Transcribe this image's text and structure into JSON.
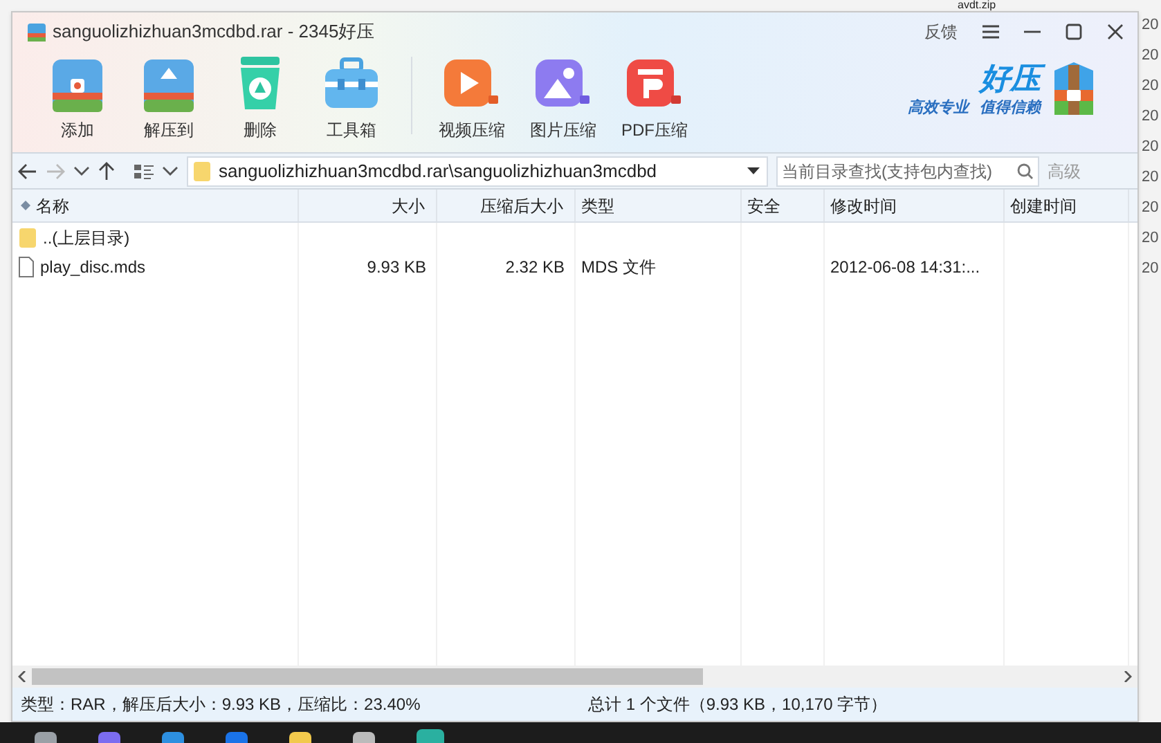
{
  "background": {
    "right_file": "avdt.zip",
    "right_dates": [
      "20",
      "20",
      "20",
      "20",
      "20",
      "20",
      "20",
      "20",
      "20"
    ]
  },
  "window": {
    "title": "sanguolizhizhuan3mcdbd.rar - 2345好压",
    "feedback": "反馈"
  },
  "toolbar": [
    {
      "label": "添加",
      "kind": "add"
    },
    {
      "label": "解压到",
      "kind": "extract"
    },
    {
      "label": "删除",
      "kind": "delete"
    },
    {
      "label": "工具箱",
      "kind": "tools"
    },
    {
      "label": "视频压缩",
      "kind": "video"
    },
    {
      "label": "图片压缩",
      "kind": "image"
    },
    {
      "label": "PDF压缩",
      "kind": "pdf"
    }
  ],
  "brand": {
    "name": "好压",
    "slogan_1": "高效专业",
    "slogan_2": "值得信赖"
  },
  "address_bar": {
    "path": "sanguolizhizhuan3mcdbd.rar\\sanguolizhizhuan3mcdbd"
  },
  "search": {
    "placeholder": "当前目录查找(支持包内查找)",
    "button": "高级"
  },
  "table": {
    "columns": [
      "名称",
      "大小",
      "压缩后大小",
      "类型",
      "安全",
      "修改时间",
      "创建时间"
    ],
    "rows": [
      {
        "kind": "folder",
        "cells": [
          "..(上层目录)",
          "",
          "",
          "",
          "",
          "",
          ""
        ]
      },
      {
        "kind": "file",
        "cells": [
          "play_disc.mds",
          "9.93 KB",
          "2.32 KB",
          "MDS 文件",
          "",
          "2012-06-08 14:31:...",
          ""
        ]
      }
    ]
  },
  "status_bar": {
    "left": "类型：RAR，解压后大小：9.93 KB，压缩比：23.40%",
    "right": "总计 1 个文件（9.93 KB，10,170 字节）"
  }
}
